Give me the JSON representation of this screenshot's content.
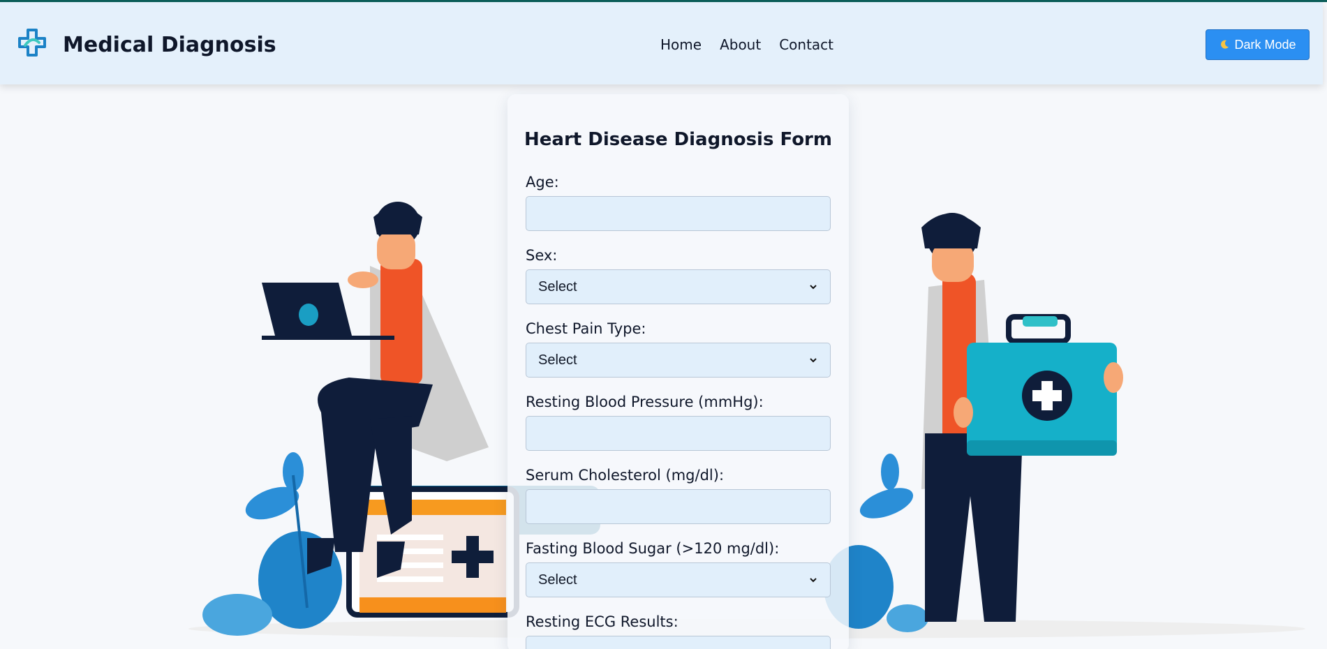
{
  "header": {
    "brand": "Medical Diagnosis",
    "nav": [
      "Home",
      "About",
      "Contact"
    ],
    "dark_mode_label": "Dark Mode",
    "dark_mode_icon": "moon-icon"
  },
  "form": {
    "title": "Heart Disease Diagnosis Form",
    "fields": [
      {
        "label": "Age:",
        "type": "input",
        "value": ""
      },
      {
        "label": "Sex:",
        "type": "select",
        "value": "Select"
      },
      {
        "label": "Chest Pain Type:",
        "type": "select",
        "value": "Select"
      },
      {
        "label": "Resting Blood Pressure (mmHg):",
        "type": "input",
        "value": ""
      },
      {
        "label": "Serum Cholesterol (mg/dl):",
        "type": "input",
        "value": ""
      },
      {
        "label": "Fasting Blood Sugar (>120 mg/dl):",
        "type": "select",
        "value": "Select"
      },
      {
        "label": "Resting ECG Results:",
        "type": "input",
        "value": ""
      }
    ]
  },
  "colors": {
    "header_bg": "#e4f0fb",
    "accent": "#2b8ff2",
    "field_bg": "#e1effb",
    "page_bg": "#f6f8fb"
  }
}
